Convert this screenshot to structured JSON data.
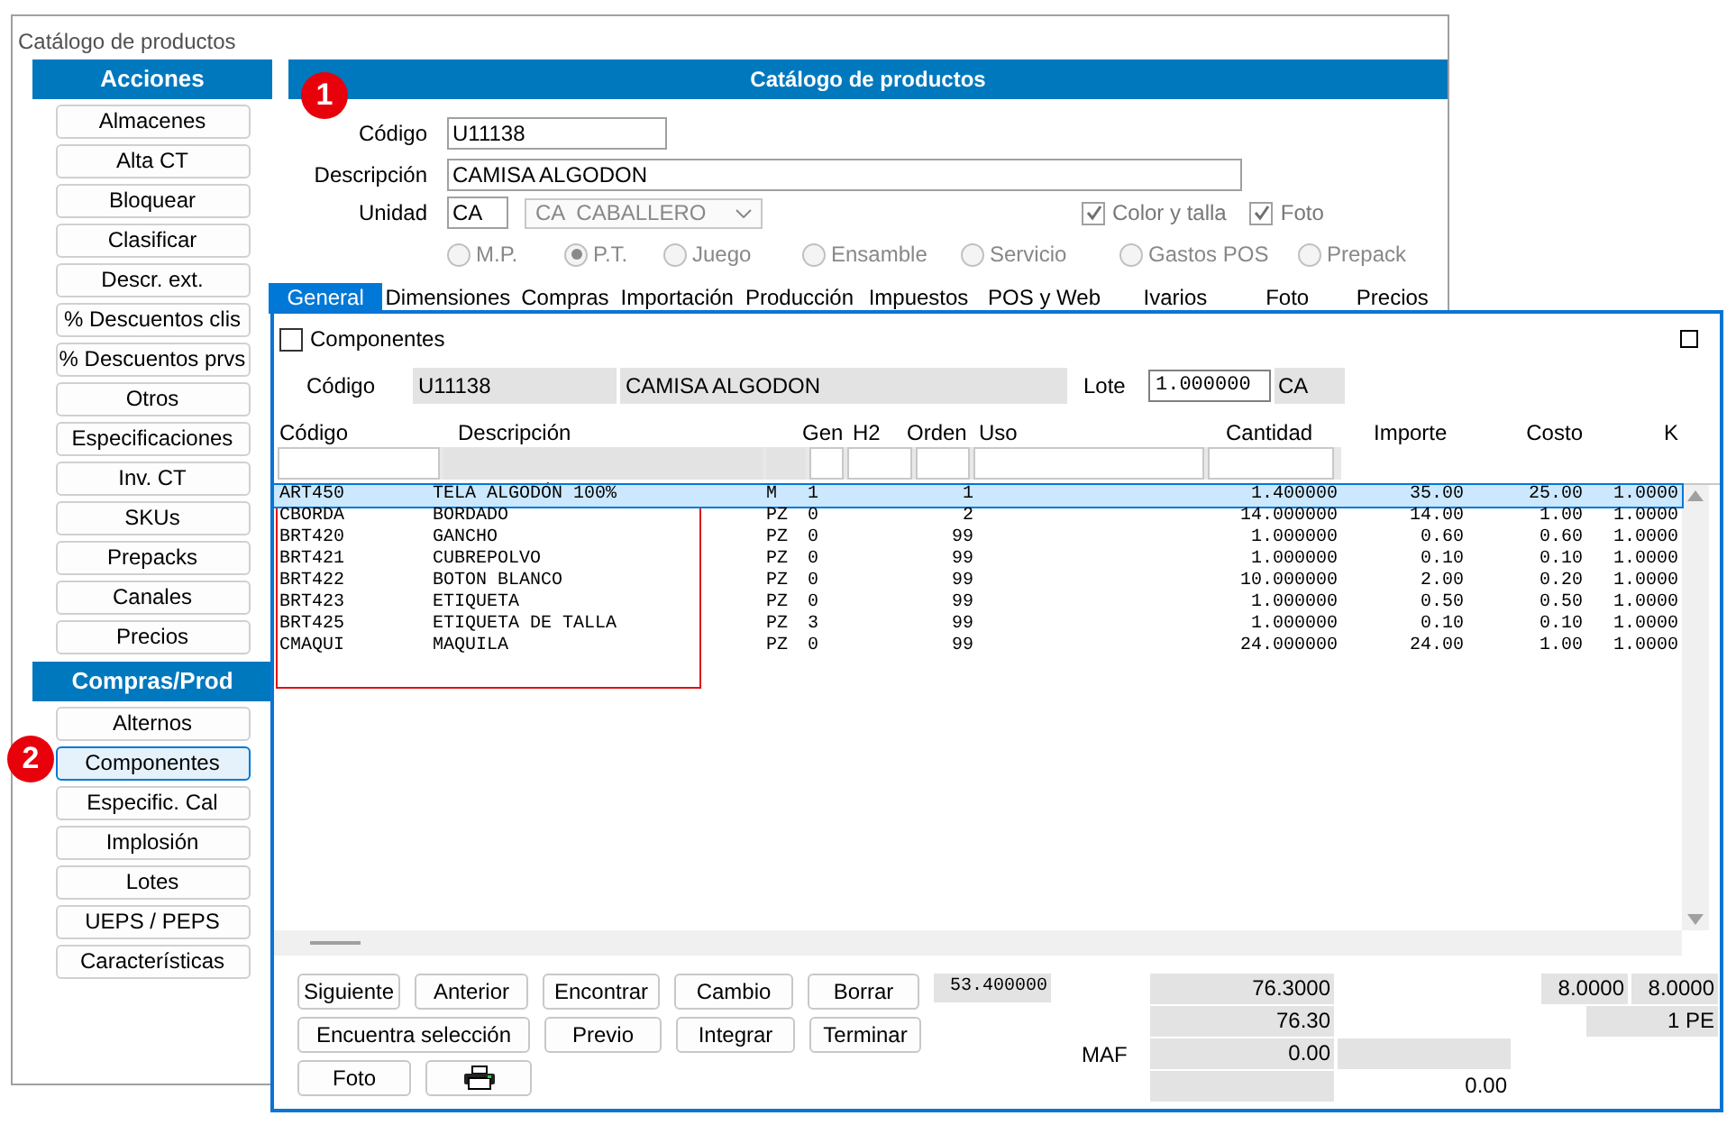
{
  "window": {
    "title": "Catálogo de productos"
  },
  "markers": [
    "1",
    "2"
  ],
  "sidebar": {
    "sections": [
      {
        "title": "Acciones",
        "items": [
          {
            "label": "Almacenes",
            "selected": false
          },
          {
            "label": "Alta CT",
            "selected": false
          },
          {
            "label": "Bloquear",
            "selected": false
          },
          {
            "label": "Clasificar",
            "selected": false
          },
          {
            "label": "Descr. ext.",
            "selected": false
          },
          {
            "label": "% Descuentos clis",
            "selected": false
          },
          {
            "label": "% Descuentos prvs",
            "selected": false
          },
          {
            "label": "Otros",
            "selected": false
          },
          {
            "label": "Especificaciones",
            "selected": false
          },
          {
            "label": "Inv. CT",
            "selected": false
          },
          {
            "label": "SKUs",
            "selected": false
          },
          {
            "label": "Prepacks",
            "selected": false
          },
          {
            "label": "Canales",
            "selected": false
          },
          {
            "label": "Precios",
            "selected": false
          }
        ]
      },
      {
        "title": "Compras/Prod",
        "items": [
          {
            "label": "Alternos",
            "selected": false
          },
          {
            "label": "Componentes",
            "selected": true
          },
          {
            "label": "Especific. Cal",
            "selected": false
          },
          {
            "label": "Implosión",
            "selected": false
          },
          {
            "label": "Lotes",
            "selected": false
          },
          {
            "label": "UEPS / PEPS",
            "selected": false
          },
          {
            "label": "Características",
            "selected": false
          }
        ]
      }
    ]
  },
  "panel": {
    "title": "Catálogo de productos",
    "codigo": {
      "label": "Código",
      "value": "U11138"
    },
    "descripcion": {
      "label": "Descripción",
      "value": "CAMISA ALGODON"
    },
    "unidad": {
      "label": "Unidad",
      "value": "CA",
      "select_value": "CA  CABALLERO",
      "disabled": true
    },
    "checkboxes": [
      {
        "label": "Color y talla",
        "checked": true,
        "disabled": true
      },
      {
        "label": "Foto",
        "checked": true,
        "disabled": true
      }
    ],
    "radios": [
      {
        "label": "M.P.",
        "selected": false,
        "disabled": true
      },
      {
        "label": "P.T.",
        "selected": true,
        "disabled": true
      },
      {
        "label": "Juego",
        "selected": false,
        "disabled": true
      },
      {
        "label": "Ensamble",
        "selected": false,
        "disabled": true
      },
      {
        "label": "Servicio",
        "selected": false,
        "disabled": true
      },
      {
        "label": "Gastos POS",
        "selected": false,
        "disabled": true
      },
      {
        "label": "Prepack",
        "selected": false,
        "disabled": true
      }
    ],
    "tabs": [
      {
        "label": "General",
        "selected": true
      },
      {
        "label": "Dimensiones",
        "selected": false
      },
      {
        "label": "Compras",
        "selected": false
      },
      {
        "label": "Importación",
        "selected": false
      },
      {
        "label": "Producción",
        "selected": false
      },
      {
        "label": "Impuestos",
        "selected": false
      },
      {
        "label": "POS y Web",
        "selected": false
      },
      {
        "label": "Ivarios",
        "selected": false
      },
      {
        "label": "Foto",
        "selected": false
      },
      {
        "label": "Precios",
        "selected": false
      }
    ]
  },
  "dialog": {
    "title": "Componentes",
    "checked": false,
    "codigo_label": "Código",
    "codigo": "U11138",
    "descripcion": "CAMISA ALGODON",
    "lote_label": "Lote",
    "lote": "1.000000",
    "lote_unit": "CA",
    "columns": [
      "Código",
      "Descripción",
      "",
      "Gen",
      "H2",
      "Orden",
      "Uso",
      "Cantidad",
      "Importe",
      "Costo",
      "K"
    ],
    "rows": [
      {
        "selected": true,
        "cells": [
          "ART450",
          "TELA ALGODÓN 100%",
          "M",
          "1",
          "",
          "1",
          "",
          "1.400000",
          "35.00",
          "25.00",
          "1.0000"
        ]
      },
      {
        "selected": false,
        "cells": [
          "CBORDA",
          "BORDADO",
          "PZ",
          "0",
          "",
          "2",
          "",
          "14.000000",
          "14.00",
          "1.00",
          "1.0000"
        ]
      },
      {
        "selected": false,
        "cells": [
          "BRT420",
          "GANCHO",
          "PZ",
          "0",
          "",
          "99",
          "",
          "1.000000",
          "0.60",
          "0.60",
          "1.0000"
        ]
      },
      {
        "selected": false,
        "cells": [
          "BRT421",
          "CUBREPOLVO",
          "PZ",
          "0",
          "",
          "99",
          "",
          "1.000000",
          "0.10",
          "0.10",
          "1.0000"
        ]
      },
      {
        "selected": false,
        "cells": [
          "BRT422",
          "BOTON BLANCO",
          "PZ",
          "0",
          "",
          "99",
          "",
          "10.000000",
          "2.00",
          "0.20",
          "1.0000"
        ]
      },
      {
        "selected": false,
        "cells": [
          "BRT423",
          "ETIQUETA",
          "PZ",
          "0",
          "",
          "99",
          "",
          "1.000000",
          "0.50",
          "0.50",
          "1.0000"
        ]
      },
      {
        "selected": false,
        "cells": [
          "BRT425",
          "ETIQUETA DE TALLA",
          "PZ",
          "3",
          "",
          "99",
          "",
          "1.000000",
          "0.10",
          "0.10",
          "1.0000"
        ]
      },
      {
        "selected": false,
        "cells": [
          "CMAQUI",
          "MAQUILA",
          "PZ",
          "0",
          "",
          "99",
          "",
          "24.000000",
          "24.00",
          "1.00",
          "1.0000"
        ]
      }
    ],
    "buttons": [
      {
        "kind": "text",
        "label": "Siguiente"
      },
      {
        "kind": "text",
        "label": "Anterior"
      },
      {
        "kind": "text",
        "label": "Encontrar"
      },
      {
        "kind": "text",
        "label": "Cambio"
      },
      {
        "kind": "text",
        "label": "Borrar"
      },
      {
        "kind": "text",
        "label": "Encuentra selección"
      },
      {
        "kind": "text",
        "label": "Previo"
      },
      {
        "kind": "text",
        "label": "Integrar"
      },
      {
        "kind": "text",
        "label": "Terminar"
      },
      {
        "kind": "text",
        "label": "Foto"
      },
      {
        "kind": "print"
      }
    ],
    "summary": {
      "total_quantity": "53.400000",
      "label": "MAF",
      "column_1": [
        "76.3000",
        "76.30",
        "0.00"
      ],
      "column_2": [
        "0.00"
      ],
      "column_3": [
        "8.0000",
        "8.0000",
        "1 PE"
      ]
    }
  }
}
